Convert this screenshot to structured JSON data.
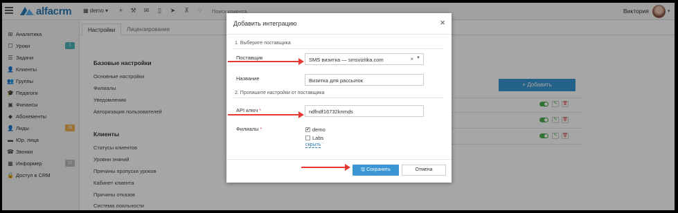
{
  "topbar": {
    "logo_text": "alfacrm",
    "branch_select": "demo",
    "branch_caret": "▾",
    "search_placeholder": "Поиск клиента",
    "user_name": "Виктория",
    "icons": [
      "plus-icon",
      "wrench-icon",
      "mail-icon",
      "phone-icon",
      "telegram-icon",
      "cart-icon",
      "bell-icon"
    ]
  },
  "sidebar": {
    "items": [
      {
        "label": "Аналитика",
        "icon": "⊞"
      },
      {
        "label": "Уроки",
        "icon": "☐",
        "badge": "1"
      },
      {
        "label": "Задачи",
        "icon": "☰"
      },
      {
        "label": "Клиенты",
        "icon": "👤"
      },
      {
        "label": "Группы",
        "icon": "👥"
      },
      {
        "label": "Педагоги",
        "icon": "🎓"
      },
      {
        "label": "Финансы",
        "icon": "▣"
      },
      {
        "label": "Абонементы",
        "icon": "◆"
      },
      {
        "label": "Лиды",
        "icon": "👤",
        "badge": "39"
      },
      {
        "label": "Юр. лица",
        "icon": "▬"
      },
      {
        "label": "Звонки",
        "icon": "☎"
      },
      {
        "label": "Информер",
        "icon": "▦",
        "badge": "10"
      },
      {
        "label": "Доступ в CRM",
        "icon": "🔒"
      }
    ]
  },
  "main": {
    "tabs": [
      "Настройки",
      "Лицензирование"
    ],
    "base_title": "Базовые настройки",
    "base_links": [
      "Основные настройки",
      "Филиалы",
      "Уведомления",
      "Авторизация пользователей"
    ],
    "clients_title": "Клиенты",
    "clients_links": [
      "Статусы клиентов",
      "Уровни знаний",
      "Причины пропуска уроков",
      "Кабинет клиента",
      "Причины отказов",
      "Система лояльности"
    ],
    "add_button": "+ Добавить"
  },
  "modal": {
    "title": "Добавить интеграцию",
    "close": "×",
    "step1": "1. Выберите поставщика",
    "provider_label": "Поставщик",
    "provider_value": "SMS визитка — smsvizitka.com",
    "provider_clear": "×",
    "provider_caret": "▼",
    "name_label": "Название",
    "name_value": "Визитка для рассылок",
    "step2": "2. Пропишите настройки от поставщика",
    "api_label": "API ключ",
    "api_value": "ndfndf16732knmds",
    "branches_label": "Филиалы",
    "required_mark": "*",
    "branches": [
      {
        "label": "demo",
        "checked": true
      },
      {
        "label": "Labs",
        "checked": false
      }
    ],
    "check_mark": "✔",
    "hide_link": "скрыть",
    "save_button": "Сохранить",
    "cancel_button": "Отмена"
  },
  "colors": {
    "accent": "#3a97d4",
    "arrow": "#e53935",
    "toggle": "#4caf50"
  }
}
